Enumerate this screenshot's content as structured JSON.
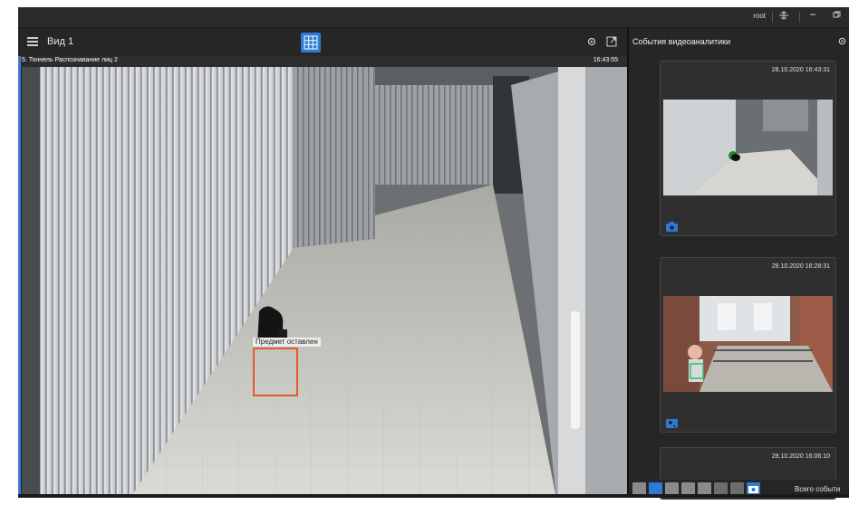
{
  "titlebar": {
    "user": "root",
    "icons": [
      "network-icon",
      "minimize-icon",
      "restore-icon"
    ]
  },
  "view": {
    "title": "Вид 1",
    "grid_icon": "grid-icon",
    "settings_icon": "gear-icon",
    "expand_icon": "expand-icon"
  },
  "camera": {
    "name": "5. Тоннель Распознавание лиц 2",
    "time": "16:43:55",
    "detection_label": "Предмет оставлен"
  },
  "events": {
    "title": "События видеоаналитики",
    "cards": [
      {
        "timestamp": "28.10.2020 16:43:31",
        "icon": "camera-icon"
      },
      {
        "timestamp": "28.10.2020 16:28:31",
        "icon": "face-icon"
      },
      {
        "timestamp": "28.10.2020 16:06:10",
        "icon": "camera-icon"
      }
    ],
    "total_label": "Всего событи"
  },
  "colors": {
    "accent": "#2e7bd6",
    "detection": "#e45a2b",
    "background": "#1f1f1f"
  }
}
